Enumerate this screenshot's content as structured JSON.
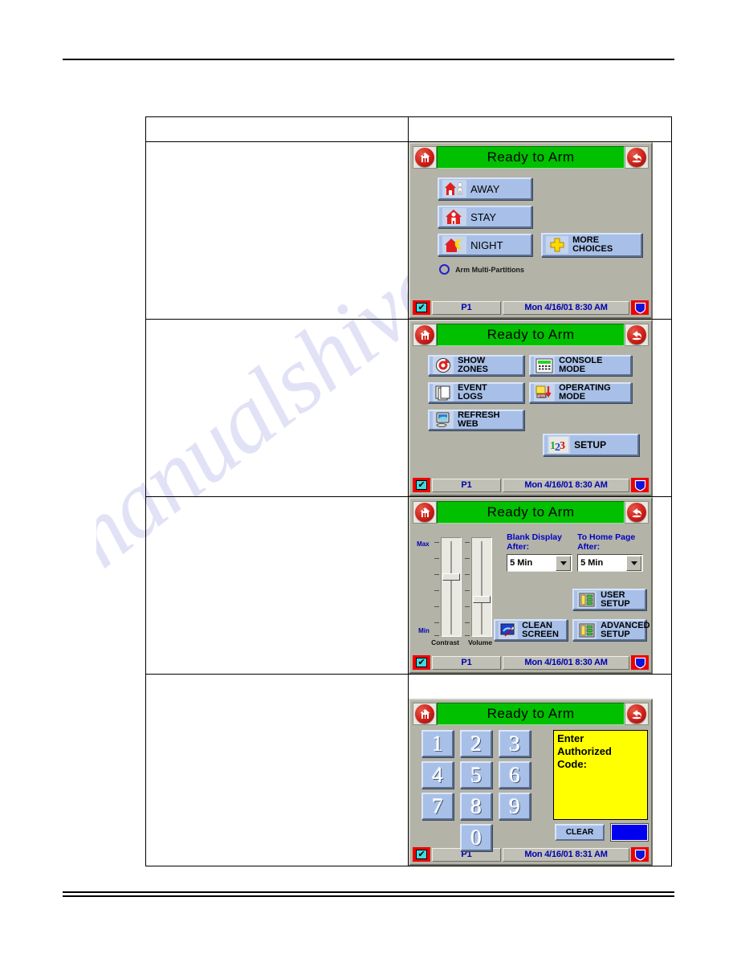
{
  "page": {
    "watermark_text": "manualshive.com"
  },
  "table": {
    "header": {
      "left": "",
      "right": ""
    },
    "rows": [
      {
        "left": "",
        "panel": "home"
      },
      {
        "left": "",
        "panel": "more_choices"
      },
      {
        "left": "",
        "panel": "setup"
      },
      {
        "left": "",
        "panel": "keypad"
      }
    ]
  },
  "panels": {
    "home": {
      "title": "Ready to Arm",
      "home_icon": "house-icon",
      "back_icon": "back-arrow-icon",
      "buttons": [
        {
          "label": "AWAY",
          "icon": "house-person-outside-icon"
        },
        {
          "label": "STAY",
          "icon": "house-person-inside-icon"
        },
        {
          "label": "NIGHT",
          "icon": "house-moon-icon"
        }
      ],
      "more_choices": {
        "label": "MORE\nCHOICES",
        "icon": "yellow-plus-icon"
      },
      "multi_partition": {
        "label": "Arm Multi-Partitions",
        "selected": false
      },
      "footer": {
        "partition": "P1",
        "datetime": "Mon 4/16/01  8:30 AM",
        "check_icon": "checkbox-icon",
        "shield_icon": "shield-icon"
      }
    },
    "more_choices": {
      "title": "Ready to Arm",
      "home_icon": "house-icon",
      "back_icon": "back-arrow-icon",
      "buttons": [
        {
          "label": "SHOW\nZONES",
          "icon": "target-arrow-icon"
        },
        {
          "label": "CONSOLE\nMODE",
          "icon": "keypad-console-icon"
        },
        {
          "label": "EVENT\nLOGS",
          "icon": "documents-icon"
        },
        {
          "label": "OPERATING\nMODE",
          "icon": "test-mode-icon"
        },
        {
          "label": "REFRESH\nWEB",
          "icon": "monitor-icon"
        },
        {
          "label": "SETUP",
          "icon": "numbers-123-icon"
        }
      ],
      "footer": {
        "partition": "P1",
        "datetime": "Mon 4/16/01  8:30 AM",
        "check_icon": "checkbox-icon",
        "shield_icon": "shield-icon"
      }
    },
    "setup": {
      "title": "Ready to Arm",
      "home_icon": "house-icon",
      "back_icon": "back-arrow-icon",
      "sliders": {
        "max_label": "Max",
        "min_label": "Min",
        "contrast_label": "Contrast",
        "volume_label": "Volume"
      },
      "fields": [
        {
          "label": "Blank Display\nAfter:",
          "value": "5 Min"
        },
        {
          "label": "To Home Page\nAfter:",
          "value": "5 Min"
        }
      ],
      "buttons": [
        {
          "label": "USER\nSETUP",
          "icon": "setup-panel-icon"
        },
        {
          "label": "CLEAN\nSCREEN",
          "icon": "clean-screen-icon"
        },
        {
          "label": "ADVANCED\nSETUP",
          "icon": "setup-panel-icon"
        }
      ],
      "footer": {
        "partition": "P1",
        "datetime": "Mon 4/16/01  8:30 AM",
        "check_icon": "checkbox-icon",
        "shield_icon": "shield-icon"
      }
    },
    "keypad": {
      "title": "Ready to Arm",
      "home_icon": "house-icon",
      "back_icon": "back-arrow-icon",
      "keys": [
        "1",
        "2",
        "3",
        "4",
        "5",
        "6",
        "7",
        "8",
        "9",
        "0"
      ],
      "prompt": "Enter\nAuthorized\nCode:",
      "clear_label": "CLEAR",
      "entry_value": "",
      "footer": {
        "partition": "P1",
        "datetime": "Mon 4/16/01  8:31 AM",
        "check_icon": "checkbox-icon",
        "shield_icon": "shield-icon"
      }
    }
  },
  "colors": {
    "status_green": "#00c000",
    "panel_gray": "#b3b3a8",
    "button_blue": "#a8c0e8",
    "prompt_yellow": "#ffff00",
    "entry_blue": "#0000ee",
    "accent_red": "#cf1f18",
    "text_blue": "#0000b0"
  }
}
